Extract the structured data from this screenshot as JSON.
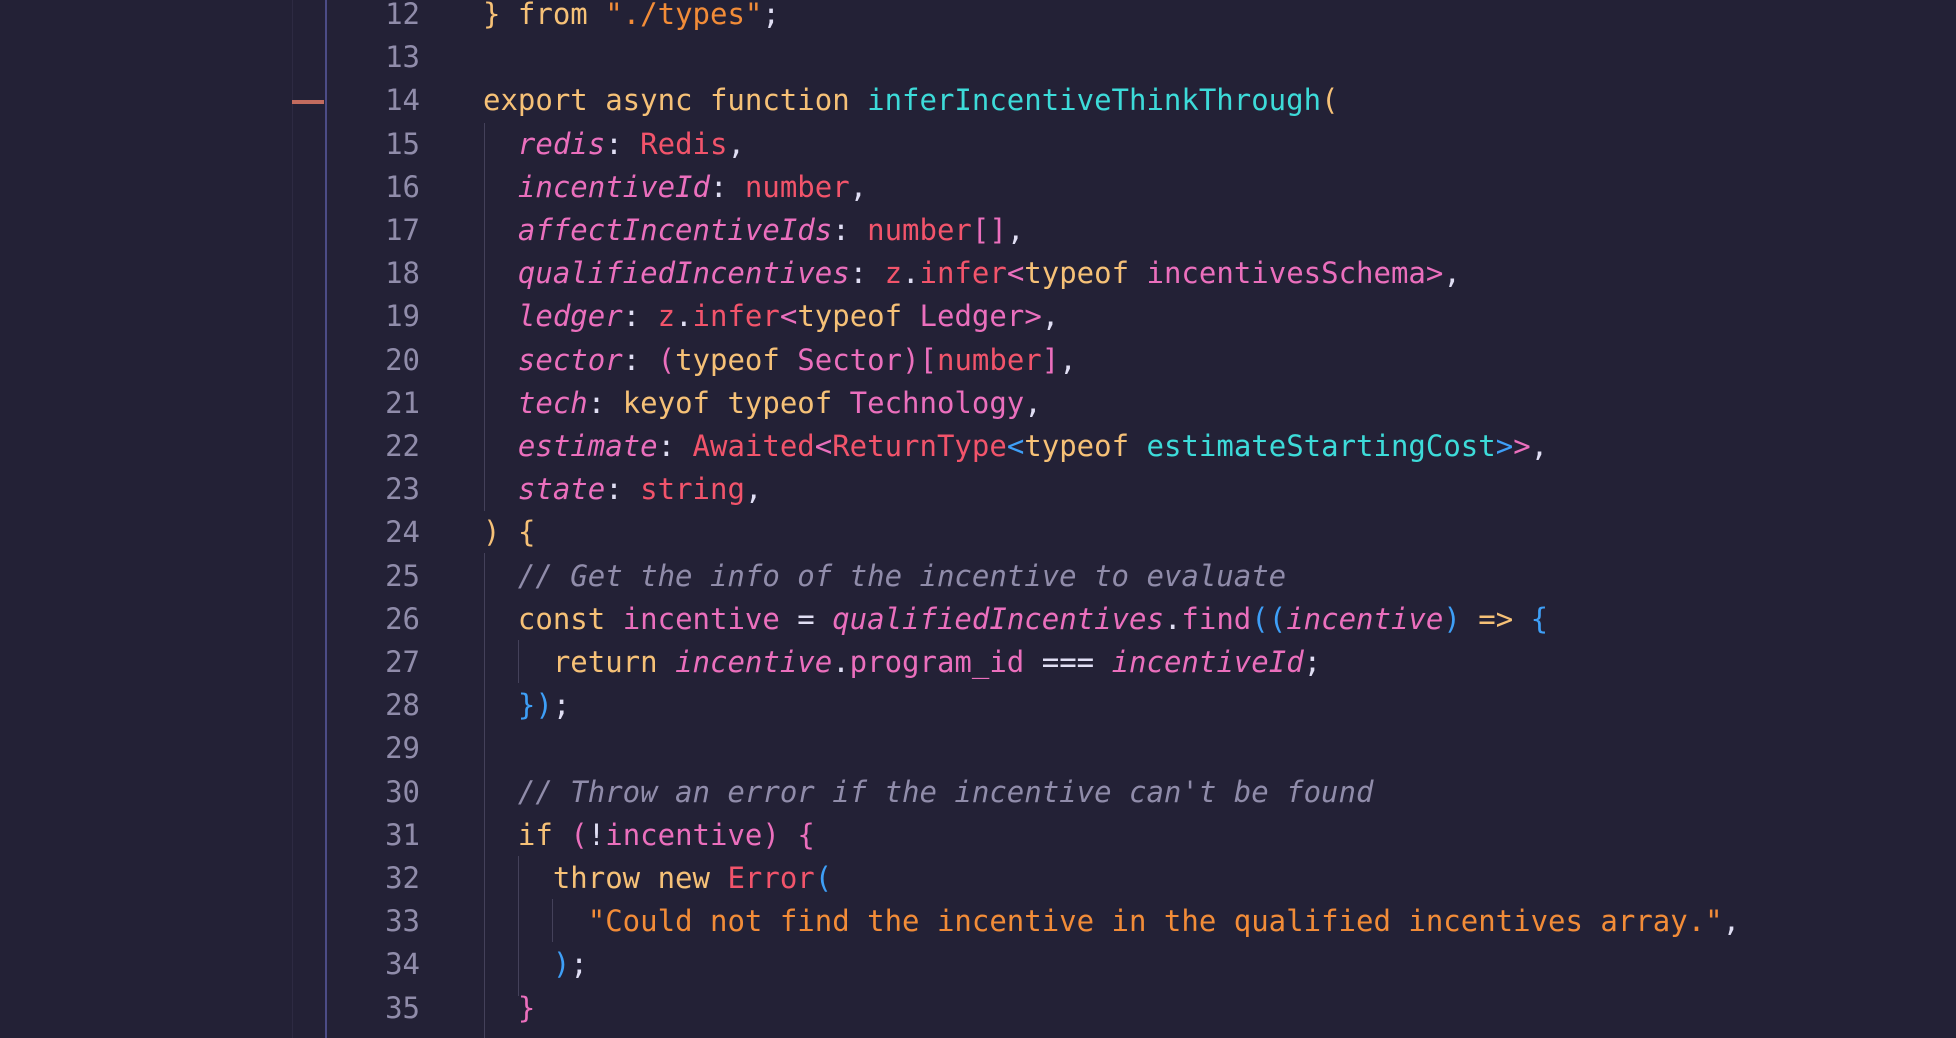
{
  "editor": {
    "language": "typescript",
    "lines": [
      {
        "n": "12",
        "tokens": [
          [
            "br1",
            "} "
          ],
          [
            "kw",
            "from "
          ],
          [
            "str",
            "\"./types\""
          ],
          [
            "plain",
            ";"
          ]
        ]
      },
      {
        "n": "13",
        "tokens": []
      },
      {
        "n": "14",
        "tokens": [
          [
            "kw",
            "export async function "
          ],
          [
            "fn",
            "inferIncentiveThinkThrough"
          ],
          [
            "br1",
            "("
          ]
        ]
      },
      {
        "n": "15",
        "tokens": [
          [
            "plain",
            "  "
          ],
          [
            "param",
            "redis"
          ],
          [
            "plain",
            ": "
          ],
          [
            "red",
            "Redis"
          ],
          [
            "plain",
            ","
          ]
        ]
      },
      {
        "n": "16",
        "tokens": [
          [
            "plain",
            "  "
          ],
          [
            "param",
            "incentiveId"
          ],
          [
            "plain",
            ": "
          ],
          [
            "red",
            "number"
          ],
          [
            "plain",
            ","
          ]
        ]
      },
      {
        "n": "17",
        "tokens": [
          [
            "plain",
            "  "
          ],
          [
            "param",
            "affectIncentiveIds"
          ],
          [
            "plain",
            ": "
          ],
          [
            "red",
            "number"
          ],
          [
            "pink",
            "[]"
          ],
          [
            "plain",
            ","
          ]
        ]
      },
      {
        "n": "18",
        "tokens": [
          [
            "plain",
            "  "
          ],
          [
            "param",
            "qualifiedIncentives"
          ],
          [
            "plain",
            ": "
          ],
          [
            "red",
            "z"
          ],
          [
            "plain",
            "."
          ],
          [
            "red",
            "infer"
          ],
          [
            "br2",
            "<"
          ],
          [
            "kw",
            "typeof "
          ],
          [
            "pink",
            "incentivesSchema"
          ],
          [
            "br2",
            ">"
          ],
          [
            "plain",
            ","
          ]
        ]
      },
      {
        "n": "19",
        "tokens": [
          [
            "plain",
            "  "
          ],
          [
            "param",
            "ledger"
          ],
          [
            "plain",
            ": "
          ],
          [
            "red",
            "z"
          ],
          [
            "plain",
            "."
          ],
          [
            "red",
            "infer"
          ],
          [
            "br2",
            "<"
          ],
          [
            "kw",
            "typeof "
          ],
          [
            "pink",
            "Ledger"
          ],
          [
            "br2",
            ">"
          ],
          [
            "plain",
            ","
          ]
        ]
      },
      {
        "n": "20",
        "tokens": [
          [
            "plain",
            "  "
          ],
          [
            "param",
            "sector"
          ],
          [
            "plain",
            ": "
          ],
          [
            "br2",
            "("
          ],
          [
            "kw",
            "typeof "
          ],
          [
            "pink",
            "Sector"
          ],
          [
            "br2",
            ")"
          ],
          [
            "br2",
            "["
          ],
          [
            "red",
            "number"
          ],
          [
            "br2",
            "]"
          ],
          [
            "plain",
            ","
          ]
        ]
      },
      {
        "n": "21",
        "tokens": [
          [
            "plain",
            "  "
          ],
          [
            "param",
            "tech"
          ],
          [
            "plain",
            ": "
          ],
          [
            "kw",
            "keyof typeof "
          ],
          [
            "pink",
            "Technology"
          ],
          [
            "plain",
            ","
          ]
        ]
      },
      {
        "n": "22",
        "tokens": [
          [
            "plain",
            "  "
          ],
          [
            "param",
            "estimate"
          ],
          [
            "plain",
            ": "
          ],
          [
            "red",
            "Awaited"
          ],
          [
            "br2",
            "<"
          ],
          [
            "red",
            "ReturnType"
          ],
          [
            "br3",
            "<"
          ],
          [
            "kw",
            "typeof "
          ],
          [
            "fn",
            "estimateStartingCost"
          ],
          [
            "br3",
            ">"
          ],
          [
            "br2",
            ">"
          ],
          [
            "plain",
            ","
          ]
        ]
      },
      {
        "n": "23",
        "tokens": [
          [
            "plain",
            "  "
          ],
          [
            "param",
            "state"
          ],
          [
            "plain",
            ": "
          ],
          [
            "red",
            "string"
          ],
          [
            "plain",
            ","
          ]
        ]
      },
      {
        "n": "24",
        "tokens": [
          [
            "br1",
            ")"
          ],
          [
            "plain",
            " "
          ],
          [
            "br1",
            "{"
          ]
        ]
      },
      {
        "n": "25",
        "tokens": [
          [
            "plain",
            "  "
          ],
          [
            "cm",
            "// Get the info of the incentive to evaluate"
          ]
        ]
      },
      {
        "n": "26",
        "tokens": [
          [
            "plain",
            "  "
          ],
          [
            "kw",
            "const "
          ],
          [
            "pink",
            "incentive"
          ],
          [
            "plain",
            " = "
          ],
          [
            "param",
            "qualifiedIncentives"
          ],
          [
            "plain",
            "."
          ],
          [
            "pink",
            "find"
          ],
          [
            "br3",
            "("
          ],
          [
            "br3",
            "("
          ],
          [
            "param",
            "incentive"
          ],
          [
            "br3",
            ")"
          ],
          [
            "plain",
            " "
          ],
          [
            "kw",
            "=>"
          ],
          [
            "plain",
            " "
          ],
          [
            "br3",
            "{"
          ]
        ]
      },
      {
        "n": "27",
        "tokens": [
          [
            "plain",
            "    "
          ],
          [
            "kw",
            "return "
          ],
          [
            "param",
            "incentive"
          ],
          [
            "plain",
            "."
          ],
          [
            "pink",
            "program_id"
          ],
          [
            "plain",
            " === "
          ],
          [
            "param",
            "incentiveId"
          ],
          [
            "plain",
            ";"
          ]
        ]
      },
      {
        "n": "28",
        "tokens": [
          [
            "plain",
            "  "
          ],
          [
            "br3",
            "}"
          ],
          [
            "br3",
            ")"
          ],
          [
            "plain",
            ";"
          ]
        ]
      },
      {
        "n": "29",
        "tokens": []
      },
      {
        "n": "30",
        "tokens": [
          [
            "plain",
            "  "
          ],
          [
            "cm",
            "// Throw an error if the incentive can't be found"
          ]
        ]
      },
      {
        "n": "31",
        "tokens": [
          [
            "plain",
            "  "
          ],
          [
            "kw",
            "if "
          ],
          [
            "br2",
            "("
          ],
          [
            "plain",
            "!"
          ],
          [
            "pink",
            "incentive"
          ],
          [
            "br2",
            ")"
          ],
          [
            "plain",
            " "
          ],
          [
            "br2",
            "{"
          ]
        ]
      },
      {
        "n": "32",
        "tokens": [
          [
            "plain",
            "    "
          ],
          [
            "kw",
            "throw new "
          ],
          [
            "red",
            "Error"
          ],
          [
            "br3",
            "("
          ]
        ]
      },
      {
        "n": "33",
        "tokens": [
          [
            "plain",
            "      "
          ],
          [
            "str",
            "\"Could not find the incentive in the qualified incentives array.\""
          ],
          [
            "plain",
            ","
          ]
        ]
      },
      {
        "n": "34",
        "tokens": [
          [
            "plain",
            "    "
          ],
          [
            "br3",
            ")"
          ],
          [
            "plain",
            ";"
          ]
        ]
      },
      {
        "n": "35",
        "tokens": [
          [
            "plain",
            "  "
          ],
          [
            "br2",
            "}"
          ]
        ]
      }
    ]
  }
}
